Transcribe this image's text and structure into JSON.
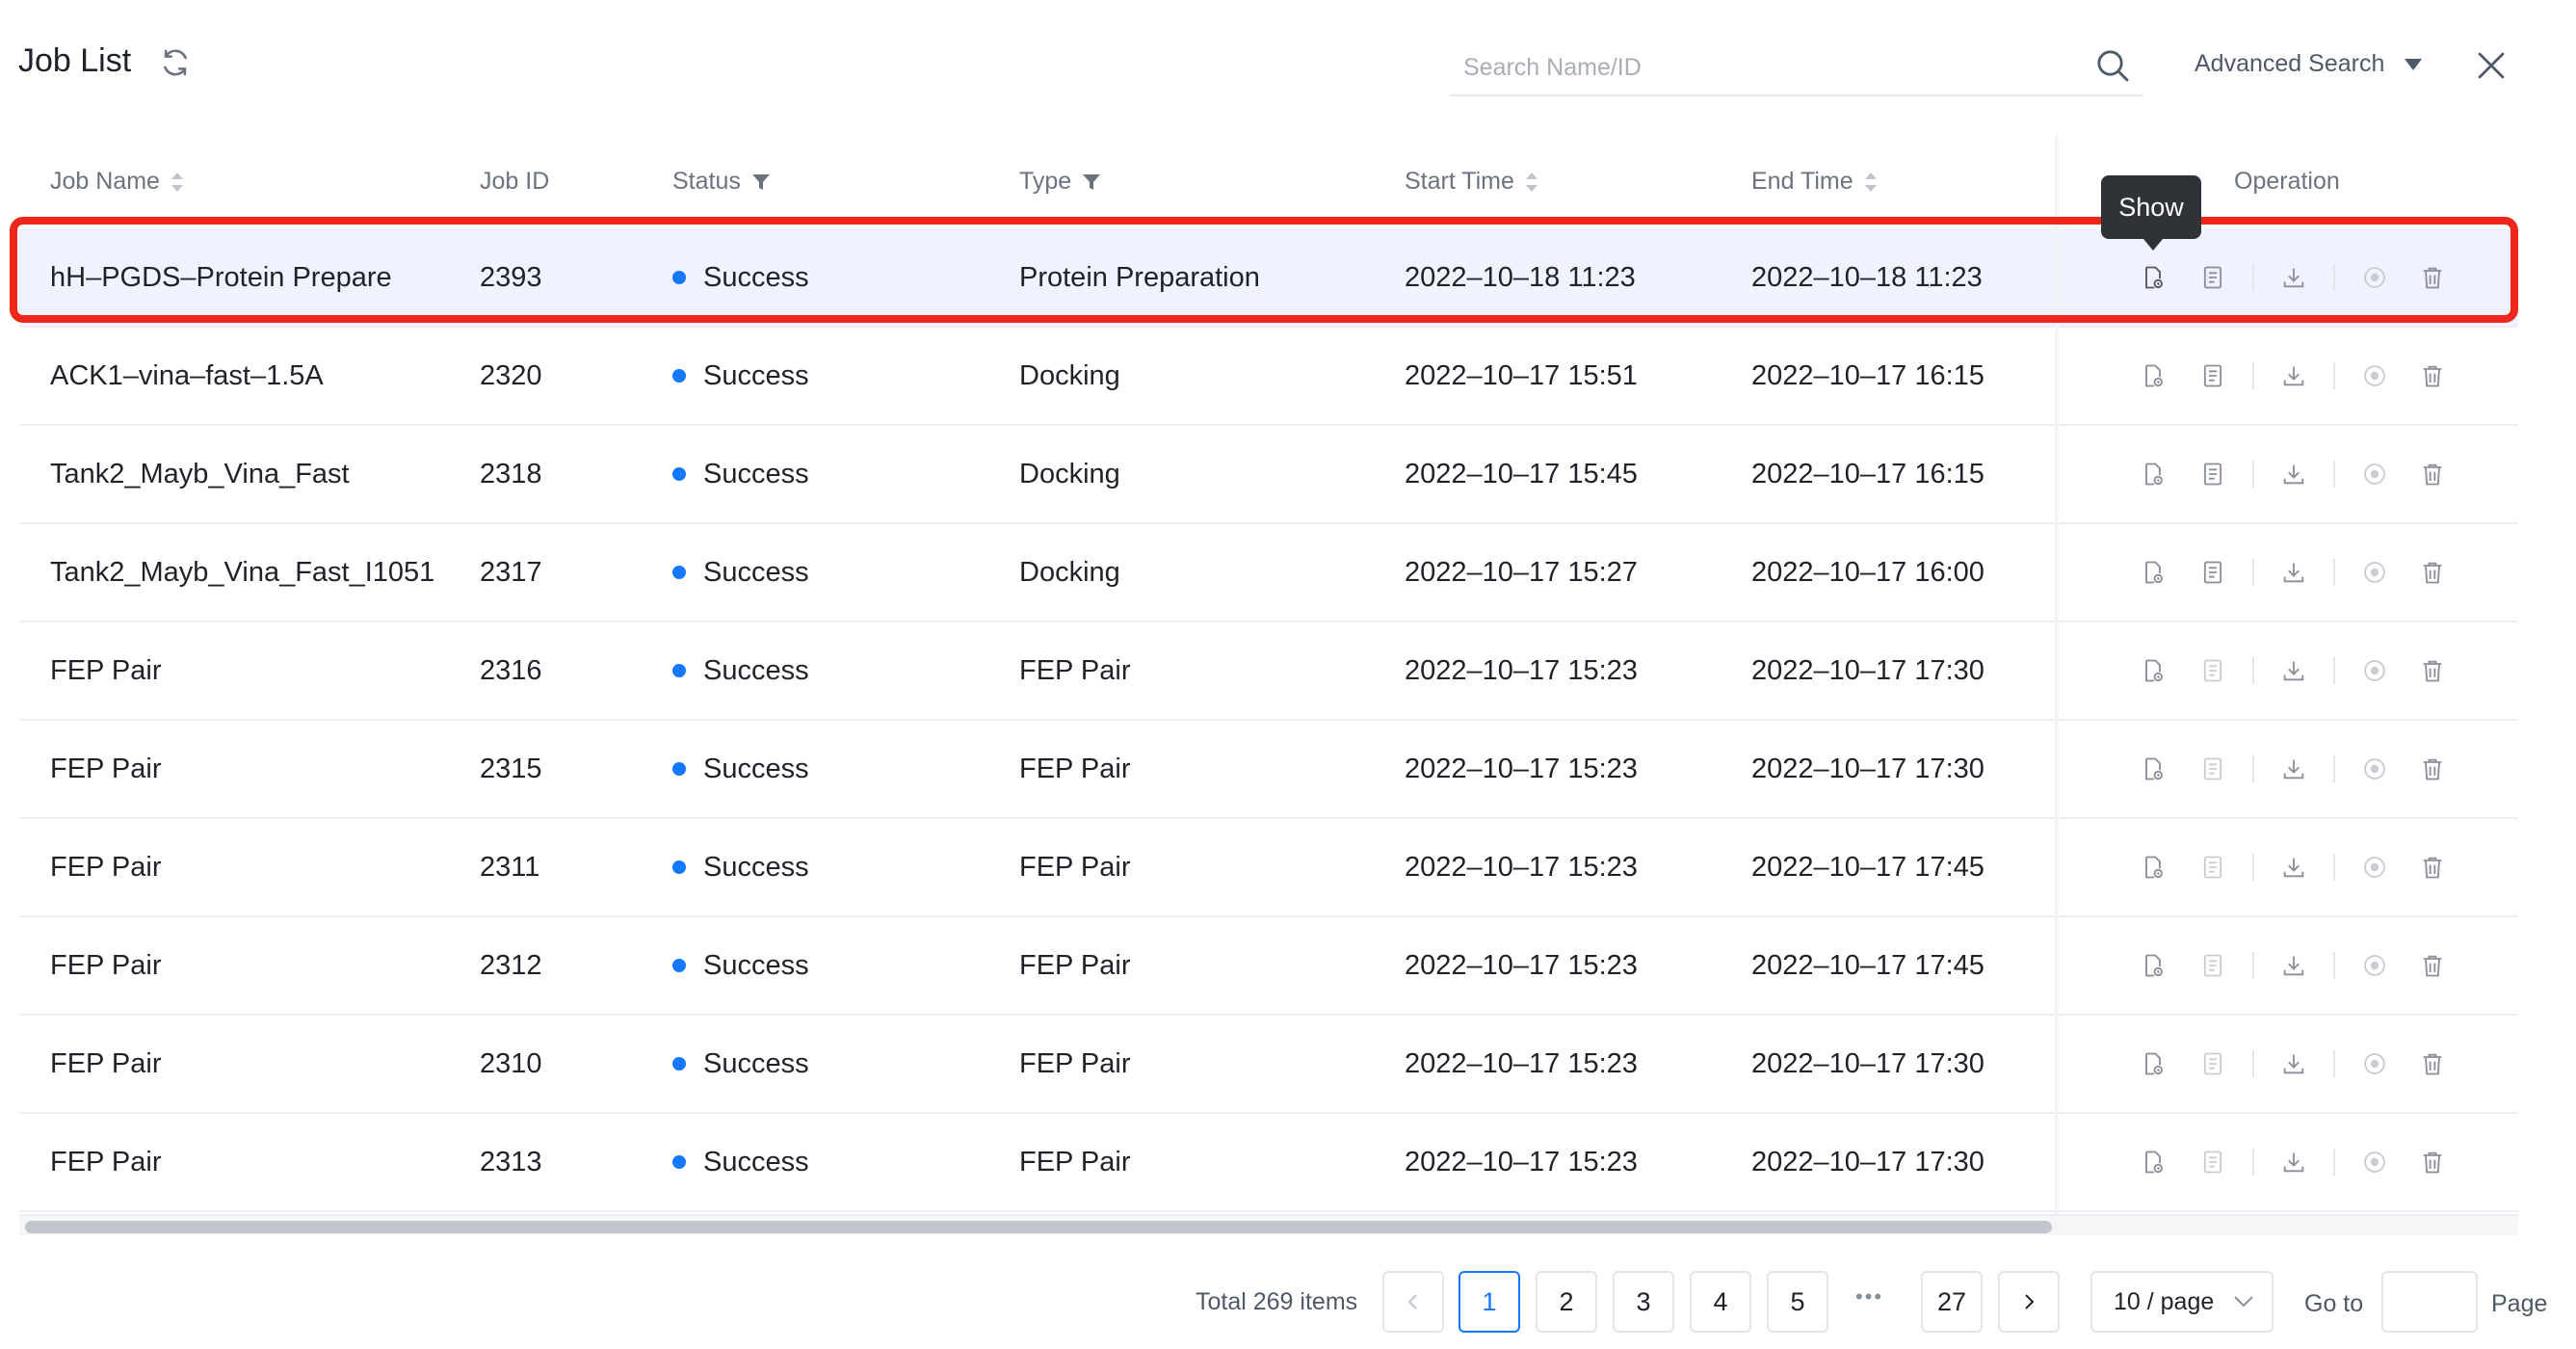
{
  "header": {
    "title": "Job List",
    "search_placeholder": "Search Name/ID",
    "advanced_search_label": "Advanced Search"
  },
  "table": {
    "columns": {
      "job_name": "Job Name",
      "job_id": "Job ID",
      "status": "Status",
      "type": "Type",
      "start_time": "Start Time",
      "end_time": "End Time",
      "operation": "Operation"
    },
    "rows": [
      {
        "name": "hH–PGDS–Protein Prepare",
        "id": "2393",
        "status": "Success",
        "type": "Protein Preparation",
        "start": "2022–10–18 11:23",
        "end": "2022–10–18 11:23",
        "report_enabled": true
      },
      {
        "name": "ACK1–vina–fast–1.5A",
        "id": "2320",
        "status": "Success",
        "type": "Docking",
        "start": "2022–10–17 15:51",
        "end": "2022–10–17 16:15",
        "report_enabled": true
      },
      {
        "name": "Tank2_Mayb_Vina_Fast",
        "id": "2318",
        "status": "Success",
        "type": "Docking",
        "start": "2022–10–17 15:45",
        "end": "2022–10–17 16:15",
        "report_enabled": true
      },
      {
        "name": "Tank2_Mayb_Vina_Fast_I1051",
        "id": "2317",
        "status": "Success",
        "type": "Docking",
        "start": "2022–10–17 15:27",
        "end": "2022–10–17 16:00",
        "report_enabled": true
      },
      {
        "name": "FEP Pair",
        "id": "2316",
        "status": "Success",
        "type": "FEP Pair",
        "start": "2022–10–17 15:23",
        "end": "2022–10–17 17:30",
        "report_enabled": false
      },
      {
        "name": "FEP Pair",
        "id": "2315",
        "status": "Success",
        "type": "FEP Pair",
        "start": "2022–10–17 15:23",
        "end": "2022–10–17 17:30",
        "report_enabled": false
      },
      {
        "name": "FEP Pair",
        "id": "2311",
        "status": "Success",
        "type": "FEP Pair",
        "start": "2022–10–17 15:23",
        "end": "2022–10–17 17:45",
        "report_enabled": false
      },
      {
        "name": "FEP Pair",
        "id": "2312",
        "status": "Success",
        "type": "FEP Pair",
        "start": "2022–10–17 15:23",
        "end": "2022–10–17 17:45",
        "report_enabled": false
      },
      {
        "name": "FEP Pair",
        "id": "2310",
        "status": "Success",
        "type": "FEP Pair",
        "start": "2022–10–17 15:23",
        "end": "2022–10–17 17:30",
        "report_enabled": false
      },
      {
        "name": "FEP Pair",
        "id": "2313",
        "status": "Success",
        "type": "FEP Pair",
        "start": "2022–10–17 15:23",
        "end": "2022–10–17 17:30",
        "report_enabled": false
      }
    ],
    "tooltip": "Show"
  },
  "pagination": {
    "total_label": "Total 269 items",
    "pages": [
      "1",
      "2",
      "3",
      "4",
      "5"
    ],
    "ellipsis": "•••",
    "last_page": "27",
    "current_page": "1",
    "page_size": "10 / page",
    "goto_label": "Go to",
    "page_label": "Page"
  },
  "colors": {
    "accent": "#1677ff",
    "highlight_row": "#f0f3fd",
    "annotation_frame": "#f2271c",
    "status_success_dot": "#1677ff"
  },
  "icons": {
    "refresh": "refresh-icon",
    "search": "search-icon",
    "advanced_caret": "caret-down-icon",
    "close": "close-icon",
    "op_show": "view-file-icon",
    "op_report": "report-icon",
    "op_download": "download-icon",
    "op_stop": "stop-circle-icon",
    "op_delete": "trash-icon"
  }
}
